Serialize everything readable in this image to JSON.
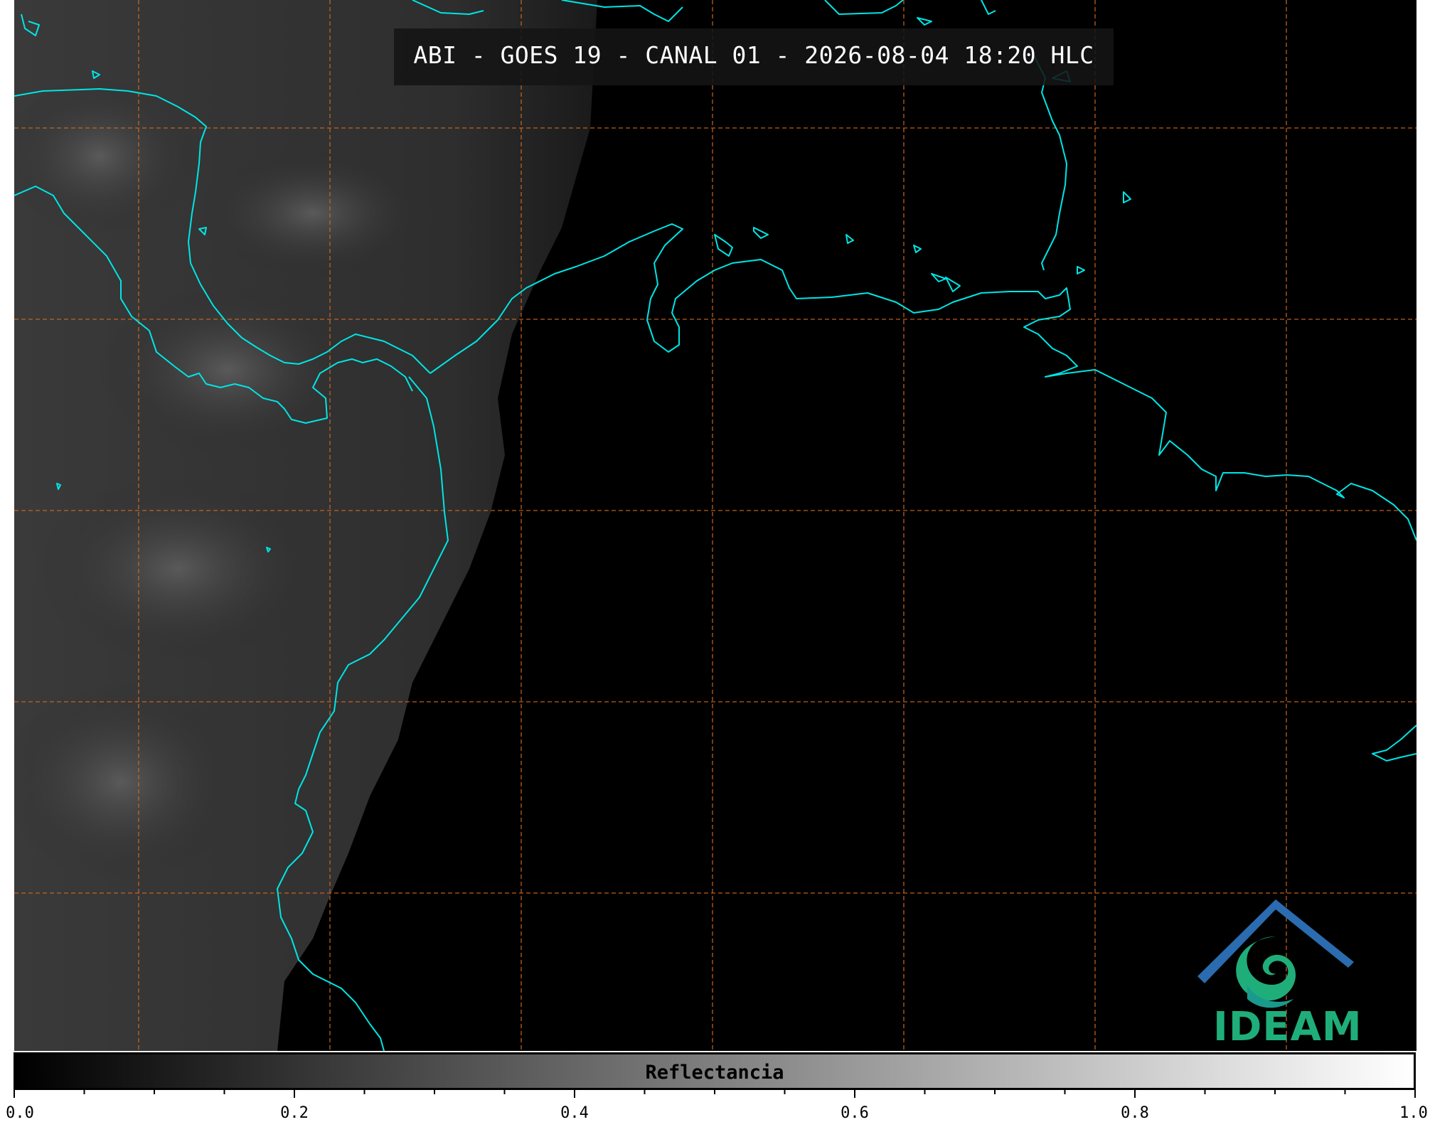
{
  "title": "ABI - GOES 19 - CANAL 01 - 2026-08-04 18:20 HLC",
  "colorbar": {
    "label": "Reflectancia",
    "min": 0.0,
    "max": 1.0,
    "tick_labels": [
      "0.0",
      "0.2",
      "0.4",
      "0.6",
      "0.8",
      "1.0"
    ],
    "colormap": [
      "#000000",
      "#ffffff"
    ]
  },
  "logo": {
    "text": "IDEAM"
  },
  "colors": {
    "coastline": "#00e5e5",
    "graticule": "#d2691e",
    "background": "#000000",
    "logo_blue": "#2b6cb0",
    "logo_green": "#1fae7a"
  },
  "icons": [
    "ideam-logo-icon"
  ]
}
